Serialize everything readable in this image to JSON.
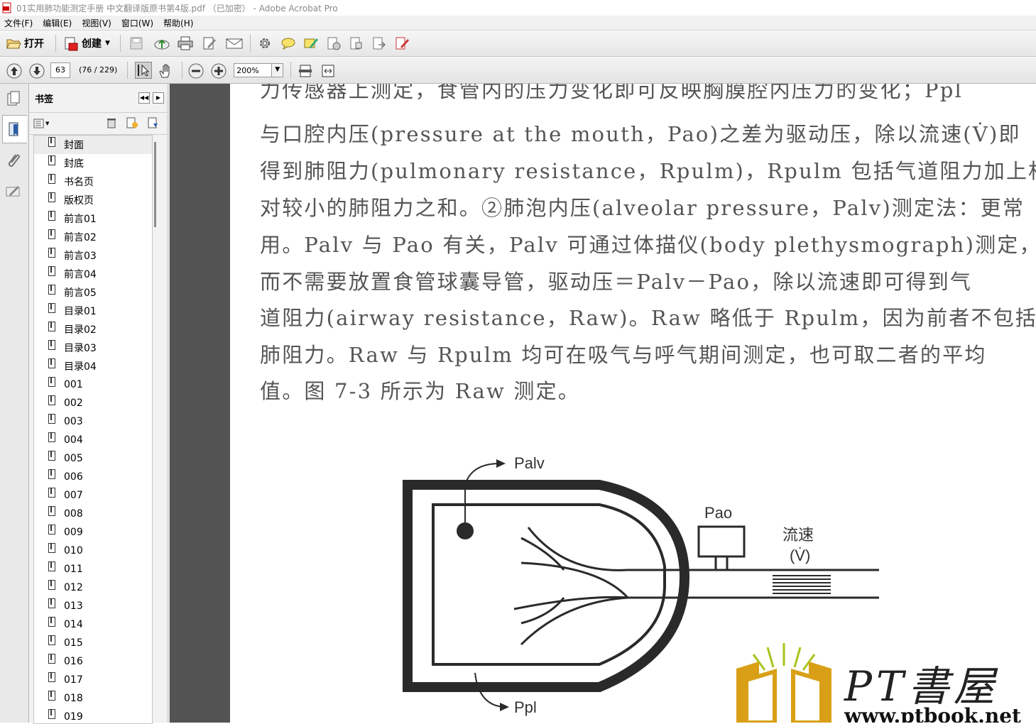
{
  "window": {
    "title": "01实用肺功能测定手册 中文翻译版原书第4版.pdf （已加密） - Adobe Acrobat Pro"
  },
  "menu": [
    "文件(F)",
    "编辑(E)",
    "视图(V)",
    "窗口(W)",
    "帮助(H)"
  ],
  "toolbar": {
    "open_label": "打开",
    "create_label": "创建"
  },
  "nav": {
    "page_value": "63",
    "page_info": "(76 / 229)",
    "zoom": "200%"
  },
  "bookmarks": {
    "title": "书签",
    "selected_index": 0,
    "items": [
      "封面",
      "封底",
      "书名页",
      "版权页",
      "前言01",
      "前言02",
      "前言03",
      "前言04",
      "前言05",
      "目录01",
      "目录02",
      "目录03",
      "目录04",
      "001",
      "002",
      "003",
      "004",
      "005",
      "006",
      "007",
      "008",
      "009",
      "010",
      "011",
      "012",
      "013",
      "014",
      "015",
      "016",
      "017",
      "018",
      "019"
    ]
  },
  "document": {
    "lines": [
      "力传感器上测定，食管内的压力变化即可反映胸膜腔内压力的变化；Ppl",
      "与口腔内压(pressure at the mouth，Pao)之差为驱动压，除以流速(V̇)即",
      "得到肺阻力(pulmonary resistance，Rpulm)，Rpulm 包括气道阻力加上相",
      "对较小的肺阻力之和。②肺泡内压(alveolar pressure，Palv)测定法：更常",
      "用。Palv 与 Pao 有关，Palv 可通过体描仪(body plethysmograph)测定，",
      "而不需要放置食管球囊导管，驱动压＝Palv－Pao，除以流速即可得到气",
      "道阻力(airway resistance，Raw)。Raw 略低于 Rpulm，因为前者不包括",
      "肺阻力。Raw 与 Rpulm 均可在吸气与呼气期间测定，也可取二者的平均",
      "值。图 7-3 所示为 Raw 测定。"
    ],
    "figure": {
      "palv": "Palv",
      "pao": "Pao",
      "flow": "流速",
      "flow_symbol": "(V̇)",
      "ppl": "Ppl"
    },
    "watermark": {
      "brand": "PT書屋",
      "url": "www.ptbook.net"
    }
  },
  "colors": {
    "dark_panel": "#535353",
    "text_gray": "#555555",
    "watermark_gold": "#d9a017",
    "watermark_green": "#a8c41a"
  }
}
